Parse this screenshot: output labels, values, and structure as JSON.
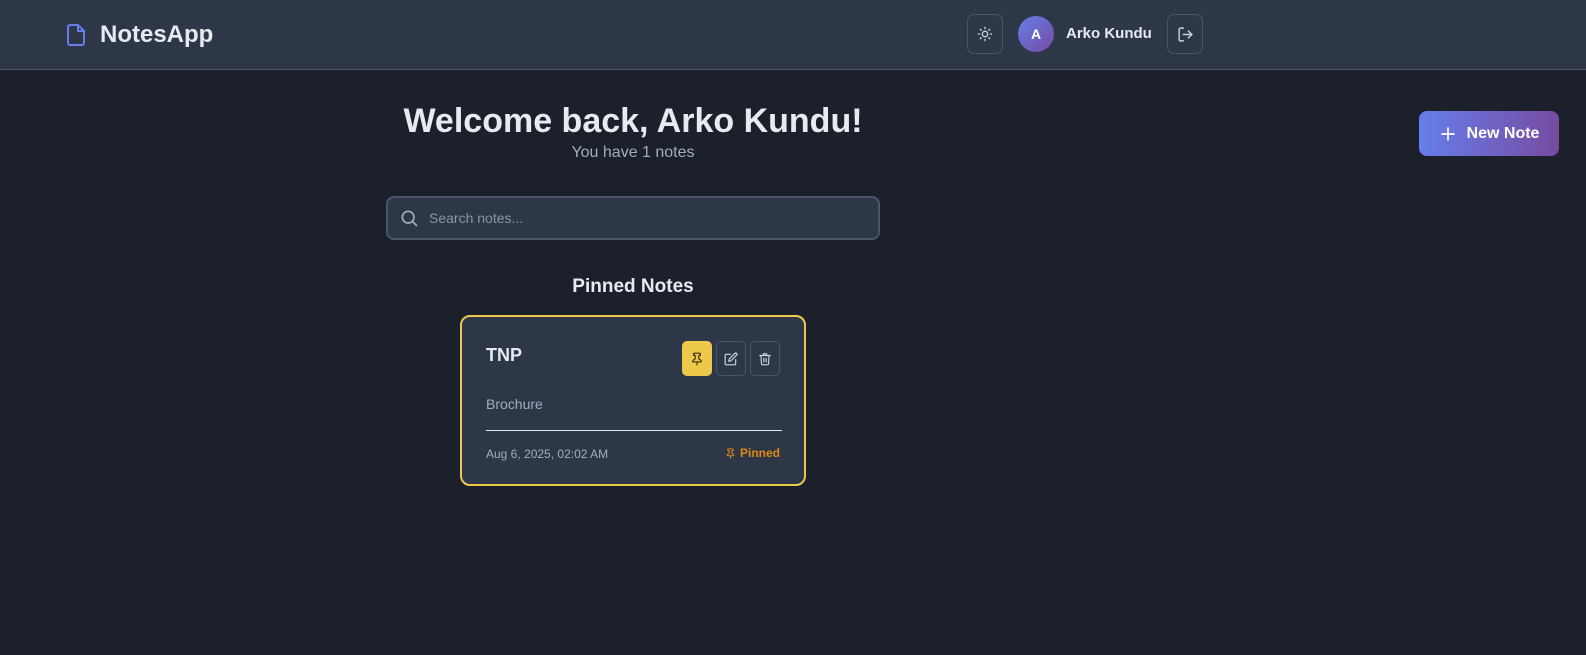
{
  "app": {
    "title": "NotesApp"
  },
  "header": {
    "user_initial": "A",
    "user_name": "Arko Kundu"
  },
  "main": {
    "welcome": "Welcome back, Arko Kundu!",
    "subtitle": "You have 1 notes",
    "new_note_label": "New Note",
    "search": {
      "placeholder": "Search notes...",
      "value": ""
    },
    "pinned_section_title": "Pinned Notes",
    "notes": [
      {
        "title": "TNP",
        "content": "Brochure",
        "date": "Aug 6, 2025, 02:02 AM",
        "badge": "Pinned",
        "pinned": true
      }
    ]
  },
  "colors": {
    "background": "#1b202b",
    "surface": "#2d3748",
    "accent_start": "#667eea",
    "accent_end": "#764ba2",
    "pin_yellow": "#ecc94b",
    "pinned_text": "#dd8a12"
  },
  "icons": {
    "brand": "document-icon",
    "theme": "sun-icon",
    "logout": "logout-icon",
    "new_note": "plus-icon",
    "search": "search-icon",
    "pin": "pin-icon",
    "edit": "edit-icon",
    "delete": "trash-icon"
  }
}
